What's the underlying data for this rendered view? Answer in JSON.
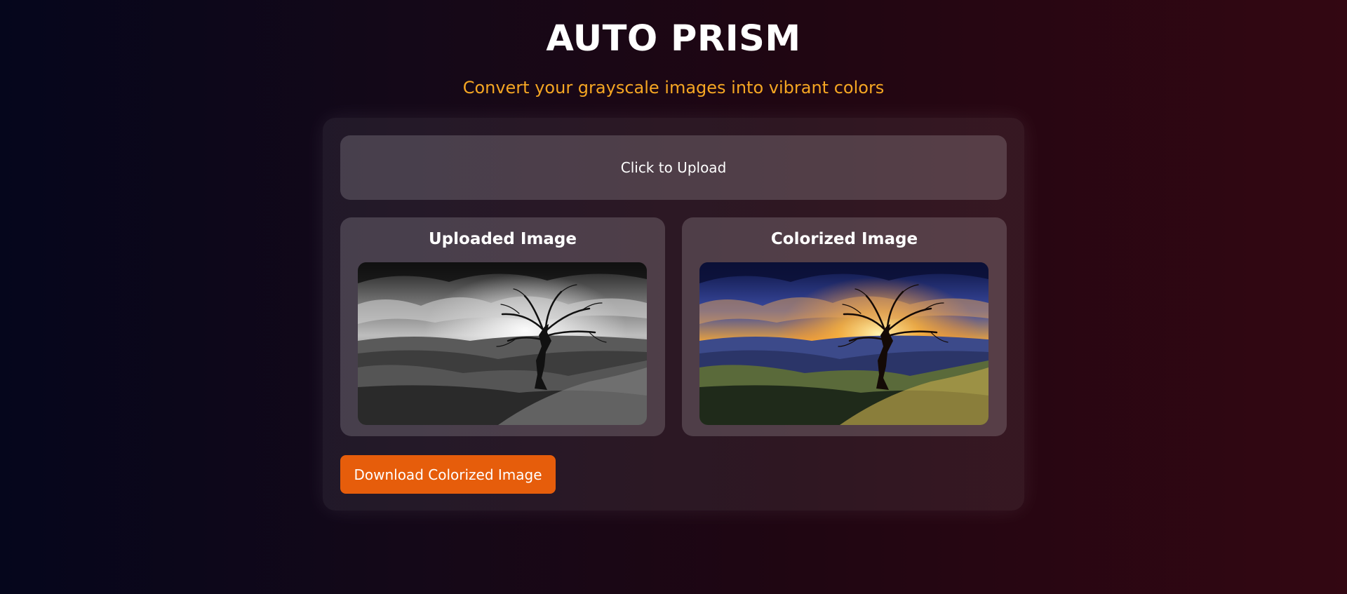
{
  "header": {
    "title": "AUTO PRISM",
    "subtitle": "Convert your grayscale images into vibrant colors"
  },
  "upload": {
    "label": "Click to Upload"
  },
  "panels": {
    "uploaded": {
      "title": "Uploaded Image",
      "image_description": "grayscale-tree-landscape"
    },
    "colorized": {
      "title": "Colorized Image",
      "image_description": "colorized-tree-sunset-landscape"
    }
  },
  "actions": {
    "download_label": "Download Colorized Image"
  },
  "colors": {
    "accent": "#f5a623",
    "button": "#e65d0b"
  }
}
